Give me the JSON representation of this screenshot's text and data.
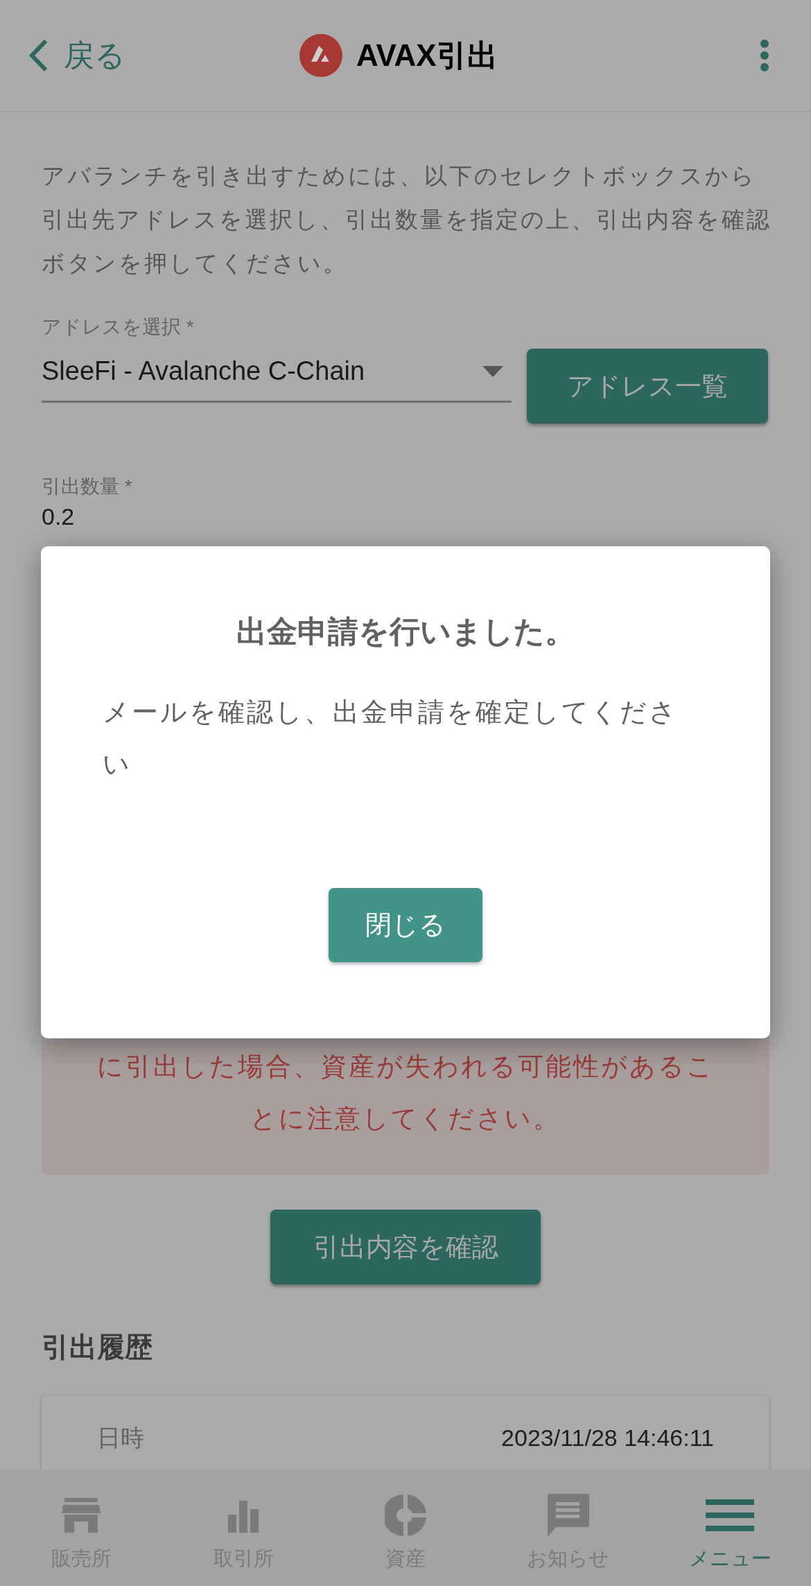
{
  "header": {
    "back": "戻る",
    "title": "AVAX引出"
  },
  "instructions": "アバランチを引き出すためには、以下のセレクトボックスから引出先アドレスを選択し、引出数量を指定の上、引出内容を確認ボタンを押してください。",
  "address": {
    "label": "アドレスを選択 *",
    "value": "SleeFi - Avalanche C-Chain",
    "button": "アドレス一覧"
  },
  "amount": {
    "label": "引出数量 *",
    "value": "0.2"
  },
  "warning": "に引出した場合、資産が失われる可能性があることに注意してください。",
  "confirm_button": "引出内容を確認",
  "history": {
    "title": "引出履歴",
    "rows": [
      {
        "label": "日時",
        "value": "2023/11/28 14:46:11"
      }
    ]
  },
  "dialog": {
    "title": "出金申請を行いました。",
    "message": "メールを確認し、出金申請を確定してください",
    "button": "閉じる"
  },
  "bottom_nav": [
    {
      "label": "販売所",
      "kind": "store",
      "selected": false
    },
    {
      "label": "取引所",
      "kind": "chart",
      "selected": false
    },
    {
      "label": "資産",
      "kind": "pie",
      "selected": false
    },
    {
      "label": "お知らせ",
      "kind": "message",
      "selected": false
    },
    {
      "label": "メニュー",
      "kind": "menu",
      "selected": true
    }
  ]
}
